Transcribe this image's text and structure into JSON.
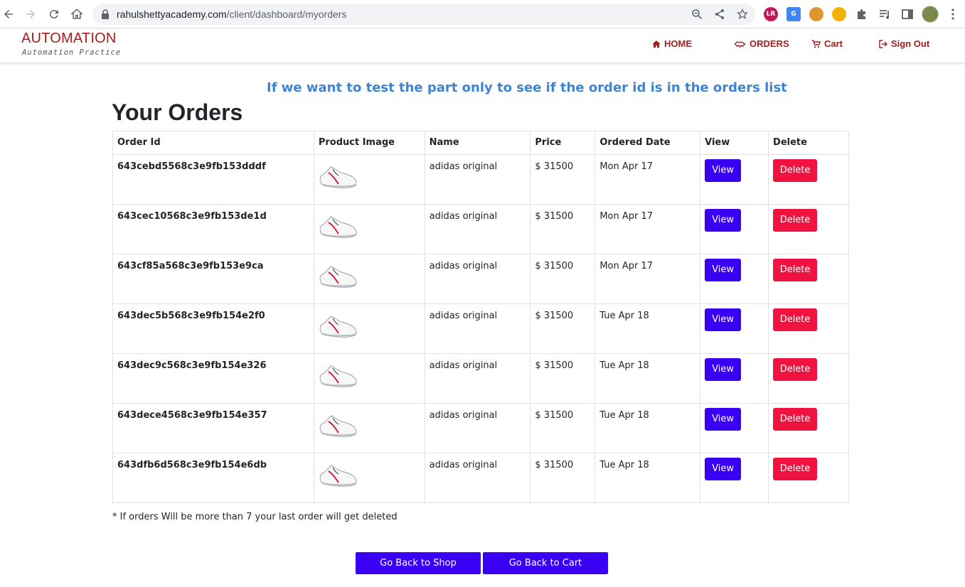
{
  "browser": {
    "url_host": "rahulshettyacademy.com",
    "url_path": "/client/dashboard/myorders",
    "extensions": [
      {
        "name": "lr-extension-icon",
        "label": "LR",
        "color": "#c2185b"
      },
      {
        "name": "google-translate-icon",
        "label": "G",
        "color": "#4285f4"
      },
      {
        "name": "cookie-icon",
        "label": "",
        "color": "#e0962f"
      },
      {
        "name": "extension-circle-icon",
        "label": "",
        "color": "#f2b000"
      }
    ]
  },
  "header": {
    "logo_title": "AUTOMATION",
    "logo_subtitle": "Automation Practice",
    "nav": {
      "home": "HOME",
      "orders": "ORDERS",
      "cart": "Cart",
      "sign_out": "Sign Out"
    }
  },
  "main": {
    "annotation": "If we want to test the part only to see if the order id is in the orders list",
    "title": "Your Orders",
    "columns": [
      "Order Id",
      "Product Image",
      "Name",
      "Price",
      "Ordered Date",
      "View",
      "Delete"
    ],
    "view_label": "View",
    "delete_label": "Delete",
    "rows": [
      {
        "order_id": "643cebd5568c3e9fb153dddf",
        "name": "adidas original",
        "price": "$ 31500",
        "date": "Mon Apr 17"
      },
      {
        "order_id": "643cec10568c3e9fb153de1d",
        "name": "adidas original",
        "price": "$ 31500",
        "date": "Mon Apr 17"
      },
      {
        "order_id": "643cf85a568c3e9fb153e9ca",
        "name": "adidas original",
        "price": "$ 31500",
        "date": "Mon Apr 17"
      },
      {
        "order_id": "643dec5b568c3e9fb154e2f0",
        "name": "adidas original",
        "price": "$ 31500",
        "date": "Tue Apr 18"
      },
      {
        "order_id": "643dec9c568c3e9fb154e326",
        "name": "adidas original",
        "price": "$ 31500",
        "date": "Tue Apr 18"
      },
      {
        "order_id": "643dece4568c3e9fb154e357",
        "name": "adidas original",
        "price": "$ 31500",
        "date": "Tue Apr 18"
      },
      {
        "order_id": "643dfb6d568c3e9fb154e6db",
        "name": "adidas original",
        "price": "$ 31500",
        "date": "Tue Apr 18"
      }
    ],
    "footnote": "* If orders Will be more than 7 your last order will get deleted",
    "back_to_shop": "Go Back to Shop",
    "back_to_cart": "Go Back to Cart"
  },
  "colors": {
    "brand_red": "#a51d1d",
    "primary_button": "#3a00f4",
    "delete_button": "#f0123f",
    "annotation_blue": "#3d84d4"
  }
}
